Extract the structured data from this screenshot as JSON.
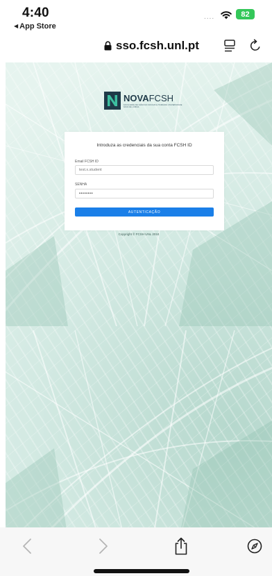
{
  "status_bar": {
    "time": "4:40",
    "back_app": "App Store",
    "signal_dots": "....",
    "battery": "82"
  },
  "address_bar": {
    "url": "sso.fcsh.unl.pt"
  },
  "logo": {
    "brand_bold": "NOVA",
    "brand_light": "FCSH",
    "tagline": "FACULDADE DE CIÊNCIAS SOCIAIS E HUMANAS UNIVERSIDADE NOVA DE LISBOA"
  },
  "login": {
    "heading": "Introduza as credenciais da sua conta FCSH ID",
    "email_label": "Email FCSH ID",
    "email_value": "test.x.student",
    "password_label": "SENHA",
    "password_value": "••••••••",
    "submit_label": "AUTENTICAÇÃO"
  },
  "footer": {
    "copyright": "Copyright © FCSH UNL 2024"
  },
  "colors": {
    "accent": "#1a7fe8",
    "battery": "#34c759",
    "background_tint": "#dcefea"
  },
  "icons": {
    "lock": "lock-icon",
    "reader": "reader-mode-icon",
    "reload": "reload-icon",
    "back": "back-arrow-icon",
    "forward": "forward-arrow-icon",
    "share": "share-icon",
    "compass": "compass-icon"
  }
}
